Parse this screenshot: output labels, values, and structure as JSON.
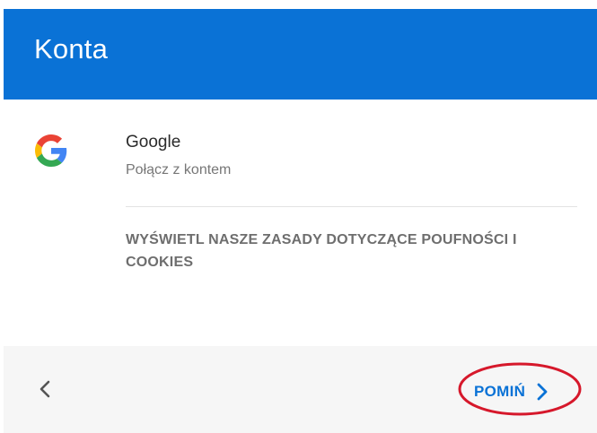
{
  "header": {
    "title": "Konta"
  },
  "account": {
    "icon": "google-logo-icon",
    "name": "Google",
    "subtitle": "Połącz z kontem"
  },
  "privacy_link": {
    "label": "WYŚWIETL NASZE ZASADY DOTYCZĄCE POUFNOŚCI I COOKIES"
  },
  "footer": {
    "back_icon": "chevron-left-icon",
    "skip_label": "POMIŃ",
    "skip_icon": "chevron-right-icon"
  },
  "colors": {
    "header_bg": "#0a72d6",
    "accent": "#0a72d6",
    "highlight": "#d6182b",
    "footer_bg": "#f6f6f6"
  }
}
